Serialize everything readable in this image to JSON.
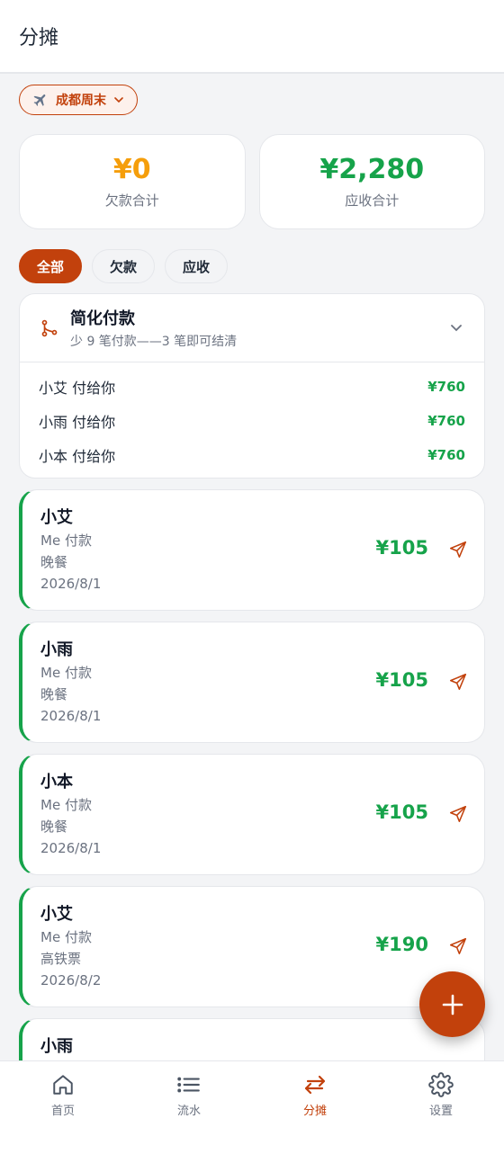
{
  "header": {
    "title": "分摊"
  },
  "trip": {
    "label": "成都周末"
  },
  "summary": {
    "owe": {
      "value": "¥0",
      "label": "欠款合计"
    },
    "receive": {
      "value": "¥2,280",
      "label": "应收合计"
    }
  },
  "filters": [
    {
      "label": "全部",
      "active": true
    },
    {
      "label": "欠款",
      "active": false
    },
    {
      "label": "应收",
      "active": false
    }
  ],
  "simplify": {
    "title": "简化付款",
    "subtitle": "少 9 笔付款——3 笔即可结清",
    "rows": [
      {
        "name": "小艾 付给你",
        "amount": "¥760"
      },
      {
        "name": "小雨 付给你",
        "amount": "¥760"
      },
      {
        "name": "小本 付给你",
        "amount": "¥760"
      }
    ]
  },
  "transactions": [
    {
      "name": "小艾",
      "payer": "Me 付款",
      "desc": "晚餐",
      "date": "2026/8/1",
      "amount": "¥105"
    },
    {
      "name": "小雨",
      "payer": "Me 付款",
      "desc": "晚餐",
      "date": "2026/8/1",
      "amount": "¥105"
    },
    {
      "name": "小本",
      "payer": "Me 付款",
      "desc": "晚餐",
      "date": "2026/8/1",
      "amount": "¥105"
    },
    {
      "name": "小艾",
      "payer": "Me 付款",
      "desc": "高铁票",
      "date": "2026/8/2",
      "amount": "¥190"
    },
    {
      "name": "小雨",
      "payer": "",
      "desc": "",
      "date": "",
      "amount": ""
    }
  ],
  "nav": [
    {
      "label": "首页",
      "icon": "home-icon"
    },
    {
      "label": "流水",
      "icon": "list-icon"
    },
    {
      "label": "分摊",
      "icon": "swap-icon",
      "active": true
    },
    {
      "label": "设置",
      "icon": "gear-icon"
    }
  ],
  "colors": {
    "accent": "#c2410c",
    "positive": "#16a34a",
    "warning": "#f59e0b"
  }
}
